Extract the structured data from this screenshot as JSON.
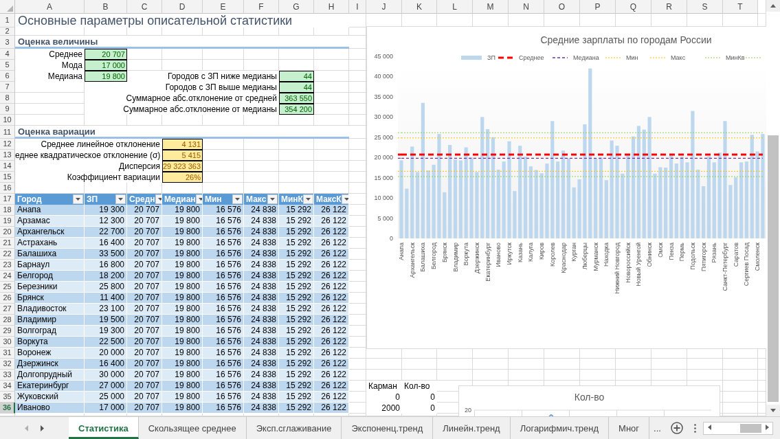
{
  "column_headers": [
    "A",
    "B",
    "C",
    "D",
    "E",
    "F",
    "G",
    "H",
    "I",
    "J",
    "K",
    "L",
    "M",
    "N",
    "O",
    "P",
    "Q",
    "R",
    "S",
    "T"
  ],
  "row_headers": [
    {
      "label": "1",
      "selected": false
    },
    {
      "label": "2",
      "selected": false
    },
    {
      "label": "3",
      "selected": false
    },
    {
      "label": "4",
      "selected": false
    },
    {
      "label": "5",
      "selected": false
    },
    {
      "label": "6",
      "selected": false
    },
    {
      "label": "7",
      "selected": false
    },
    {
      "label": "8",
      "selected": false
    },
    {
      "label": "9",
      "selected": false
    },
    {
      "label": "10",
      "selected": false
    },
    {
      "label": "11",
      "selected": false
    },
    {
      "label": "12",
      "selected": false
    },
    {
      "label": "13",
      "selected": false
    },
    {
      "label": "14",
      "selected": false
    },
    {
      "label": "15",
      "selected": false
    },
    {
      "label": "16",
      "selected": false
    },
    {
      "label": "17",
      "selected": false
    },
    {
      "label": "18",
      "selected": false
    },
    {
      "label": "19",
      "selected": false
    },
    {
      "label": "20",
      "selected": false
    },
    {
      "label": "21",
      "selected": false
    },
    {
      "label": "22",
      "selected": false
    },
    {
      "label": "23",
      "selected": false
    },
    {
      "label": "24",
      "selected": false
    },
    {
      "label": "25",
      "selected": false
    },
    {
      "label": "26",
      "selected": false
    },
    {
      "label": "27",
      "selected": false
    },
    {
      "label": "28",
      "selected": false
    },
    {
      "label": "29",
      "selected": false
    },
    {
      "label": "30",
      "selected": false
    },
    {
      "label": "31",
      "selected": false
    },
    {
      "label": "32",
      "selected": false
    },
    {
      "label": "33",
      "selected": false
    },
    {
      "label": "34",
      "selected": false
    },
    {
      "label": "35",
      "selected": false
    },
    {
      "label": "36",
      "selected": true
    }
  ],
  "title": "Основные параметры описательной статистики",
  "magnitude": {
    "heading": "Оценка величины",
    "stats": [
      {
        "label": "Среднее",
        "value": "20 707"
      },
      {
        "label": "Мода",
        "value": "17 000"
      },
      {
        "label": "Медиана",
        "value": "19 800"
      }
    ],
    "counts": [
      {
        "label": "Городов с ЗП ниже медианы",
        "value": "44"
      },
      {
        "label": "Городов с ЗП выше медианы",
        "value": "44"
      },
      {
        "label": "Суммарное абс.отклонение от средней",
        "value": "363 550"
      },
      {
        "label": "Суммарное абс.отклонение от медианы",
        "value": "354 200"
      }
    ]
  },
  "variation": {
    "heading": "Оценка вариации",
    "stats": [
      {
        "label": "Среднее линейное отклонение",
        "value": "4 131"
      },
      {
        "label": "еднее квадратическое отклонение (σ)",
        "value": "5 415"
      },
      {
        "label": "Дисперсия",
        "value": "29 323 363"
      },
      {
        "label": "Коэффициент вариации",
        "value": "26%"
      }
    ]
  },
  "table": {
    "columns": [
      "Город",
      "ЗП",
      "Средн",
      "Медиан",
      "Мин",
      "Макс",
      "МинК",
      "МаксК"
    ],
    "rows": [
      [
        "Анапа",
        "19 300",
        "20 707",
        "19 800",
        "16 576",
        "24 838",
        "15 292",
        "26 122"
      ],
      [
        "Арзамас",
        "12 300",
        "20 707",
        "19 800",
        "16 576",
        "24 838",
        "15 292",
        "26 122"
      ],
      [
        "Архангельск",
        "22 700",
        "20 707",
        "19 800",
        "16 576",
        "24 838",
        "15 292",
        "26 122"
      ],
      [
        "Астрахань",
        "16 400",
        "20 707",
        "19 800",
        "16 576",
        "24 838",
        "15 292",
        "26 122"
      ],
      [
        "Балашиха",
        "33 500",
        "20 707",
        "19 800",
        "16 576",
        "24 838",
        "15 292",
        "26 122"
      ],
      [
        "Барнаул",
        "16 800",
        "20 707",
        "19 800",
        "16 576",
        "24 838",
        "15 292",
        "26 122"
      ],
      [
        "Белгород",
        "18 200",
        "20 707",
        "19 800",
        "16 576",
        "24 838",
        "15 292",
        "26 122"
      ],
      [
        "Березники",
        "25 800",
        "20 707",
        "19 800",
        "16 576",
        "24 838",
        "15 292",
        "26 122"
      ],
      [
        "Брянск",
        "11 400",
        "20 707",
        "19 800",
        "16 576",
        "24 838",
        "15 292",
        "26 122"
      ],
      [
        "Владивосток",
        "23 100",
        "20 707",
        "19 800",
        "16 576",
        "24 838",
        "15 292",
        "26 122"
      ],
      [
        "Владимир",
        "19 500",
        "20 707",
        "19 800",
        "16 576",
        "24 838",
        "15 292",
        "26 122"
      ],
      [
        "Волгоград",
        "19 300",
        "20 707",
        "19 800",
        "16 576",
        "24 838",
        "15 292",
        "26 122"
      ],
      [
        "Воркута",
        "22 500",
        "20 707",
        "19 800",
        "16 576",
        "24 838",
        "15 292",
        "26 122"
      ],
      [
        "Воронеж",
        "20 000",
        "20 707",
        "19 800",
        "16 576",
        "24 838",
        "15 292",
        "26 122"
      ],
      [
        "Дзержинск",
        "16 400",
        "20 707",
        "19 800",
        "16 576",
        "24 838",
        "15 292",
        "26 122"
      ],
      [
        "Долгопрудный",
        "30 000",
        "20 707",
        "19 800",
        "16 576",
        "24 838",
        "15 292",
        "26 122"
      ],
      [
        "Екатеринбург",
        "27 000",
        "20 707",
        "19 800",
        "16 576",
        "24 838",
        "15 292",
        "26 122"
      ],
      [
        "Жуковский",
        "25 000",
        "20 707",
        "19 800",
        "16 576",
        "24 838",
        "15 292",
        "26 122"
      ],
      [
        "Иваново",
        "17 000",
        "20 707",
        "19 800",
        "16 576",
        "24 838",
        "15 292",
        "26 122"
      ]
    ]
  },
  "bins_table": {
    "columns": [
      "Карман",
      "Кол-во"
    ],
    "rows": [
      [
        "0",
        "0"
      ],
      [
        "2000",
        "0"
      ]
    ]
  },
  "chart": {
    "chart_data": {
      "type": "bar",
      "title": "Средние зарплаты по городам России",
      "categories": [
        "Анапа",
        null,
        "Архангельск",
        null,
        "Балашиха",
        null,
        "Белгород",
        null,
        "Брянск",
        null,
        "Владимир",
        null,
        "Воркута",
        null,
        "Дзержинск",
        null,
        "Екатеринбург",
        null,
        "Иваново",
        null,
        "Иркутск",
        null,
        "Казань",
        null,
        "Калуга",
        null,
        "Киров",
        null,
        "Королев",
        null,
        "Краснодар",
        null,
        "Курган",
        null,
        "Люберцы",
        null,
        "Мурманск",
        null,
        "Находка",
        null,
        "Нижний Новгород",
        null,
        "Новороссийск",
        null,
        "Новый Уренгой",
        null,
        "Обнинск",
        null,
        "Омск",
        null,
        "Пенза",
        null,
        "Пермь",
        null,
        "Подольск",
        null,
        "Пятигорск",
        null,
        "Рязань",
        null,
        "Санкт-Петербург",
        null,
        "Саратов",
        null,
        "Сергиев Посад",
        null,
        "Смоленск",
        null
      ],
      "series": [
        {
          "name": "ЗП",
          "color": "#bdd7ee",
          "values": [
            19300,
            12300,
            22700,
            16400,
            33500,
            16800,
            18200,
            25800,
            11400,
            23100,
            19500,
            19300,
            22500,
            20000,
            16400,
            30000,
            27000,
            25000,
            17000,
            19000,
            24000,
            11700,
            22900,
            20200,
            17800,
            16900,
            16100,
            18500,
            29000,
            19000,
            21700,
            19800,
            12600,
            14600,
            28200,
            42000,
            19700,
            20000,
            14400,
            24200,
            22900,
            16000,
            20700,
            25200,
            27800,
            26900,
            30000,
            16000,
            17600,
            17500,
            20600,
            18500,
            20200,
            18800,
            31500,
            17000,
            12900,
            20300,
            18800,
            21200,
            29000,
            13200,
            15100,
            18800,
            19000,
            25600,
            21500,
            25800
          ]
        },
        {
          "name": "Среднее",
          "type": "line",
          "line_style": "dashed-thick",
          "color": "#ff0000",
          "values": [
            20707,
            20707,
            20707,
            20707,
            20707,
            20707,
            20707,
            20707,
            20707,
            20707,
            20707,
            20707,
            20707,
            20707,
            20707,
            20707,
            20707,
            20707,
            20707,
            20707,
            20707,
            20707,
            20707,
            20707,
            20707,
            20707,
            20707,
            20707,
            20707,
            20707,
            20707,
            20707,
            20707,
            20707,
            20707,
            20707,
            20707,
            20707,
            20707,
            20707,
            20707,
            20707,
            20707,
            20707,
            20707,
            20707,
            20707,
            20707,
            20707,
            20707,
            20707,
            20707,
            20707,
            20707,
            20707,
            20707,
            20707,
            20707,
            20707,
            20707,
            20707,
            20707,
            20707,
            20707,
            20707,
            20707,
            20707,
            20707
          ]
        },
        {
          "name": "Медиана",
          "type": "line",
          "line_style": "dashed",
          "color": "#7030a0",
          "values": [
            19800,
            19800,
            19800,
            19800,
            19800,
            19800,
            19800,
            19800,
            19800,
            19800,
            19800,
            19800,
            19800,
            19800,
            19800,
            19800,
            19800,
            19800,
            19800,
            19800,
            19800,
            19800,
            19800,
            19800,
            19800,
            19800,
            19800,
            19800,
            19800,
            19800,
            19800,
            19800,
            19800,
            19800,
            19800,
            19800,
            19800,
            19800,
            19800,
            19800,
            19800,
            19800,
            19800,
            19800,
            19800,
            19800,
            19800,
            19800,
            19800,
            19800,
            19800,
            19800,
            19800,
            19800,
            19800,
            19800,
            19800,
            19800,
            19800,
            19800,
            19800,
            19800,
            19800,
            19800,
            19800,
            19800,
            19800,
            19800
          ]
        },
        {
          "name": "Мин",
          "type": "line",
          "line_style": "dotted",
          "color": "#ffc000",
          "values": [
            16576,
            16576,
            16576,
            16576,
            16576,
            16576,
            16576,
            16576,
            16576,
            16576,
            16576,
            16576,
            16576,
            16576,
            16576,
            16576,
            16576,
            16576,
            16576,
            16576,
            16576,
            16576,
            16576,
            16576,
            16576,
            16576,
            16576,
            16576,
            16576,
            16576,
            16576,
            16576,
            16576,
            16576,
            16576,
            16576,
            16576,
            16576,
            16576,
            16576,
            16576,
            16576,
            16576,
            16576,
            16576,
            16576,
            16576,
            16576,
            16576,
            16576,
            16576,
            16576,
            16576,
            16576,
            16576,
            16576,
            16576,
            16576,
            16576,
            16576,
            16576,
            16576,
            16576,
            16576,
            16576,
            16576,
            16576,
            16576
          ]
        },
        {
          "name": "Макс",
          "type": "line",
          "line_style": "dotted",
          "color": "#ffc000",
          "values": [
            24838,
            24838,
            24838,
            24838,
            24838,
            24838,
            24838,
            24838,
            24838,
            24838,
            24838,
            24838,
            24838,
            24838,
            24838,
            24838,
            24838,
            24838,
            24838,
            24838,
            24838,
            24838,
            24838,
            24838,
            24838,
            24838,
            24838,
            24838,
            24838,
            24838,
            24838,
            24838,
            24838,
            24838,
            24838,
            24838,
            24838,
            24838,
            24838,
            24838,
            24838,
            24838,
            24838,
            24838,
            24838,
            24838,
            24838,
            24838,
            24838,
            24838,
            24838,
            24838,
            24838,
            24838,
            24838,
            24838,
            24838,
            24838,
            24838,
            24838,
            24838,
            24838,
            24838,
            24838,
            24838,
            24838,
            24838,
            24838
          ]
        },
        {
          "name": "МинКв",
          "type": "line",
          "line_style": "dotted",
          "color": "#92d050",
          "values": [
            15292,
            15292,
            15292,
            15292,
            15292,
            15292,
            15292,
            15292,
            15292,
            15292,
            15292,
            15292,
            15292,
            15292,
            15292,
            15292,
            15292,
            15292,
            15292,
            15292,
            15292,
            15292,
            15292,
            15292,
            15292,
            15292,
            15292,
            15292,
            15292,
            15292,
            15292,
            15292,
            15292,
            15292,
            15292,
            15292,
            15292,
            15292,
            15292,
            15292,
            15292,
            15292,
            15292,
            15292,
            15292,
            15292,
            15292,
            15292,
            15292,
            15292,
            15292,
            15292,
            15292,
            15292,
            15292,
            15292,
            15292,
            15292,
            15292,
            15292,
            15292,
            15292,
            15292,
            15292,
            15292,
            15292,
            15292,
            15292
          ]
        },
        {
          "type": "line",
          "line_style": "dotted",
          "color": "#92d050",
          "values": [
            26122,
            26122,
            26122,
            26122,
            26122,
            26122,
            26122,
            26122,
            26122,
            26122,
            26122,
            26122,
            26122,
            26122,
            26122,
            26122,
            26122,
            26122,
            26122,
            26122,
            26122,
            26122,
            26122,
            26122,
            26122,
            26122,
            26122,
            26122,
            26122,
            26122,
            26122,
            26122,
            26122,
            26122,
            26122,
            26122,
            26122,
            26122,
            26122,
            26122,
            26122,
            26122,
            26122,
            26122,
            26122,
            26122,
            26122,
            26122,
            26122,
            26122,
            26122,
            26122,
            26122,
            26122,
            26122,
            26122,
            26122,
            26122,
            26122,
            26122,
            26122,
            26122,
            26122,
            26122,
            26122,
            26122,
            26122,
            26122
          ]
        }
      ],
      "legend": "top",
      "ylim": [
        0,
        45000
      ],
      "yticks": [
        {
          "value": 0,
          "label": "0"
        },
        {
          "value": 5000,
          "label": "5 000"
        },
        {
          "value": 10000,
          "label": "10 000"
        },
        {
          "value": 15000,
          "label": "15 000"
        },
        {
          "value": 20000,
          "label": "20 000"
        },
        {
          "value": 25000,
          "label": "25 000"
        },
        {
          "value": 30000,
          "label": "30 000"
        },
        {
          "value": 35000,
          "label": "35 000"
        },
        {
          "value": 40000,
          "label": "40 000"
        },
        {
          "value": 45000,
          "label": "45 000"
        }
      ]
    }
  },
  "histogram_chart": {
    "title": "Кол-во",
    "tick": "20"
  },
  "sheet_tabs": [
    {
      "label": "Статистика",
      "selected": true
    },
    {
      "label": "Скользящее среднее",
      "selected": false
    },
    {
      "label": "Эксп.сглаживание",
      "selected": false
    },
    {
      "label": "Экспоненц.тренд",
      "selected": false
    },
    {
      "label": "Линейн.тренд",
      "selected": false
    },
    {
      "label": "Логарифмич.тренд",
      "selected": false
    },
    {
      "label": "Мног",
      "selected": false
    }
  ],
  "tabs_overflow": "..."
}
